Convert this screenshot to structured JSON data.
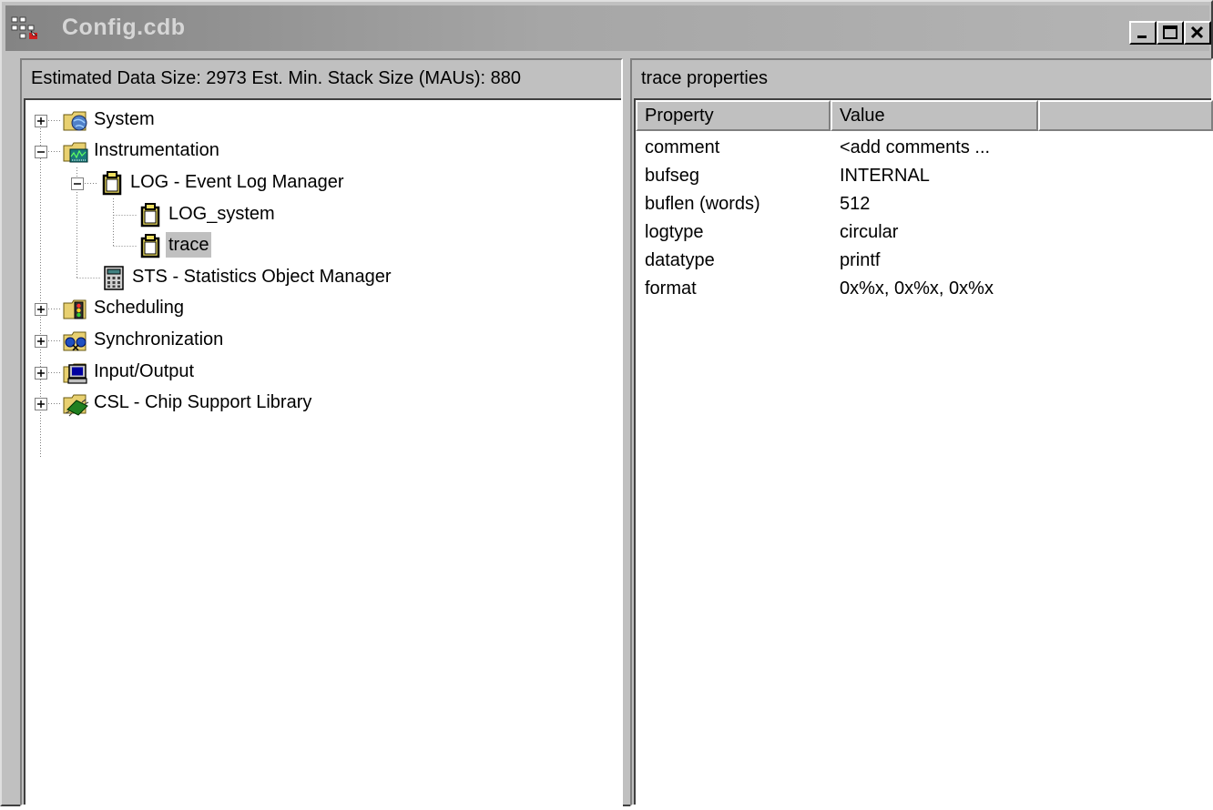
{
  "window": {
    "title": "Config.cdb",
    "controls": [
      "minimize-icon",
      "maximize-icon",
      "close-icon"
    ]
  },
  "left_pane": {
    "header": "Estimated Data Size: 2973   Est. Min. Stack Size (MAUs): 880",
    "tree": [
      {
        "label": "System",
        "icon": "system-icon",
        "expanded": false
      },
      {
        "label": "Instrumentation",
        "icon": "instrumentation-icon",
        "expanded": true
      },
      {
        "label": "LOG - Event Log Manager",
        "icon": "log-manager-icon",
        "expanded": true
      },
      {
        "label": "LOG_system",
        "icon": "log-object-icon"
      },
      {
        "label": "trace",
        "icon": "log-object-icon",
        "selected": true
      },
      {
        "label": "STS - Statistics Object Manager",
        "icon": "calculator-icon"
      },
      {
        "label": "Scheduling",
        "icon": "scheduling-icon",
        "expanded": false
      },
      {
        "label": "Synchronization",
        "icon": "synchronization-icon",
        "expanded": false
      },
      {
        "label": "Input/Output",
        "icon": "computer-icon",
        "expanded": false
      },
      {
        "label": "CSL - Chip Support Library",
        "icon": "chip-icon",
        "expanded": false
      }
    ]
  },
  "right_pane": {
    "header": "trace properties",
    "columns": [
      "Property",
      "Value"
    ],
    "rows": [
      {
        "property": "comment",
        "value": "<add comments ..."
      },
      {
        "property": "bufseg",
        "value": "INTERNAL"
      },
      {
        "property": "buflen (words)",
        "value": "512"
      },
      {
        "property": "logtype",
        "value": "circular"
      },
      {
        "property": "datatype",
        "value": "printf"
      },
      {
        "property": "format",
        "value": "0x%x, 0x%x, 0x%x"
      }
    ]
  },
  "colors": {
    "face": "#c0c0c0",
    "titlebar_start": "#848484",
    "titlebar_end": "#b5b5b5",
    "selection": "#c0c0c0"
  }
}
